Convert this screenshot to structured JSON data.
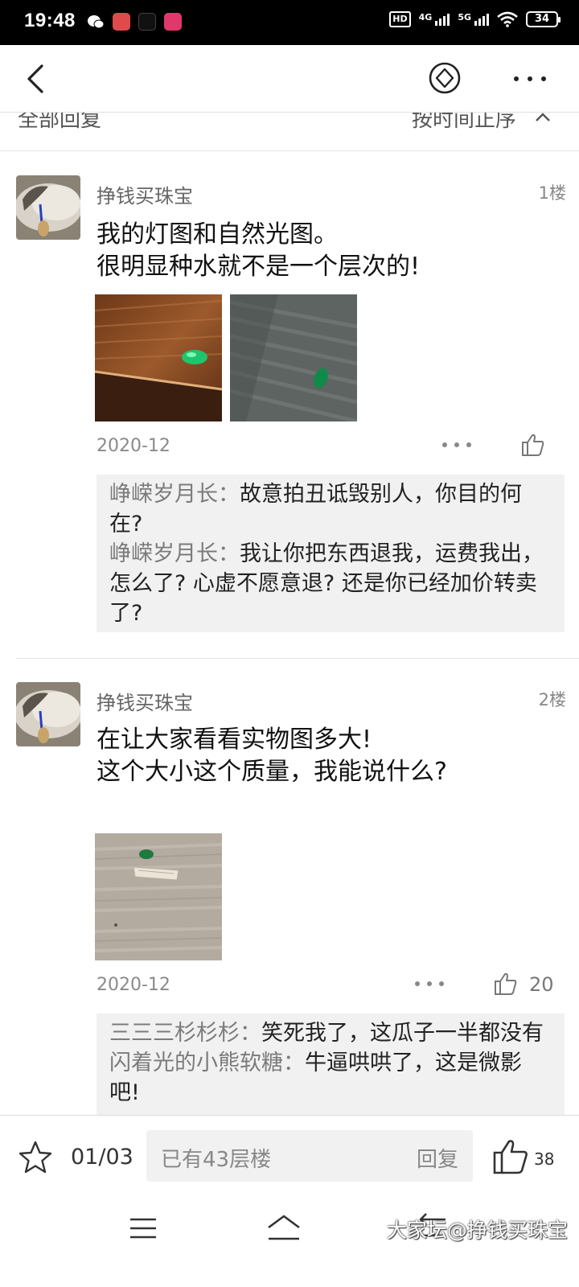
{
  "status_bar": {
    "time": "19:48",
    "hd": "HD",
    "net1": "4G",
    "net2": "5G",
    "battery": "34",
    "app_icon_colors": [
      "#e04a4a",
      "#111111",
      "#e0386a"
    ]
  },
  "header": {
    "back_icon": "chevron-left-icon",
    "center_icon": "diamond-circle-icon",
    "more_icon": "more-horizontal-icon"
  },
  "sort_bar": {
    "left_label": "全部回复",
    "right_label": "按时间正序"
  },
  "posts": [
    {
      "author": "挣钱买珠宝",
      "floor": "1楼",
      "text_lines": [
        "我的灯图和自然光图。",
        "很明显种水就不是一个层次的!"
      ],
      "date": "2020-12",
      "like_count": "",
      "replies": [
        {
          "name": "峥嵘岁月长",
          "sep": "：",
          "text": "故意拍丑诋毁别人，你目的何在?"
        },
        {
          "name": "峥嵘岁月长",
          "sep": "：",
          "text": "我让你把东西退我，运费我出，怎么了? 心虚不愿意退? 还是你已经加价转卖了?"
        }
      ]
    },
    {
      "author": "挣钱买珠宝",
      "floor": "2楼",
      "text_lines": [
        "在让大家看看实物图多大!",
        "这个大小这个质量，我能说什么?"
      ],
      "date": "2020-12",
      "like_count": "20",
      "replies": [
        {
          "name": "三三三杉杉杉",
          "sep": "：",
          "text": "笑死我了，这瓜子一半都没有"
        },
        {
          "name": "闪着光的小熊软糖",
          "sep": "：",
          "text": "牛逼哄哄了，这是微影吧!"
        }
      ]
    }
  ],
  "bottom_bar": {
    "page": "01/03",
    "placeholder": "已有43层楼",
    "reply_label": "回复",
    "like_count": "38"
  },
  "watermark": "大家坛@挣钱买珠宝"
}
